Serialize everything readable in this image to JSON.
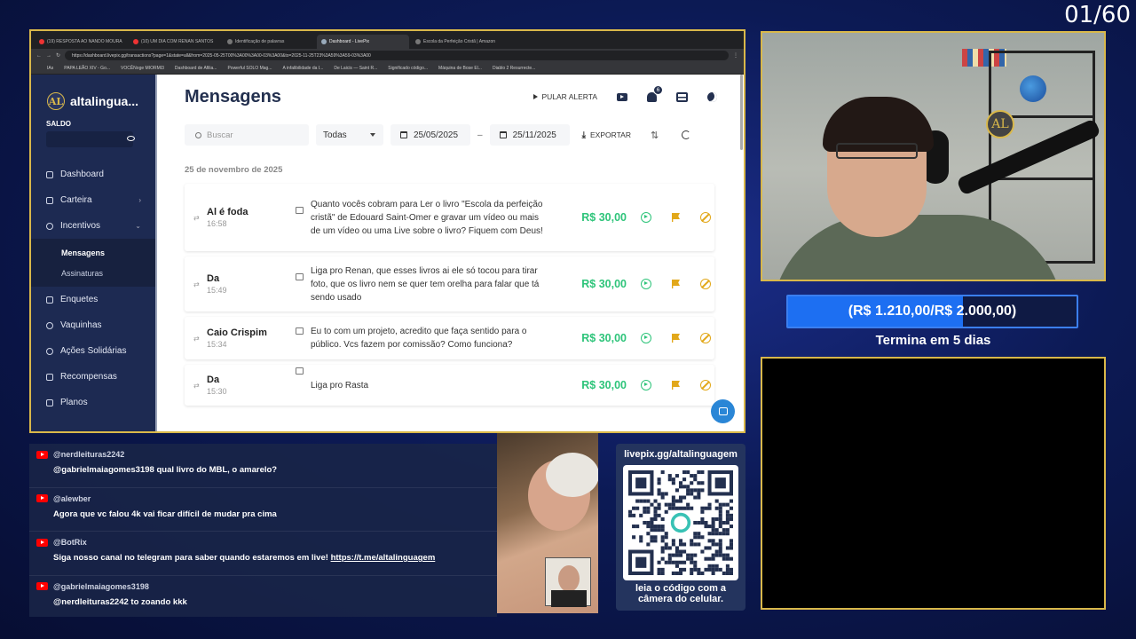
{
  "overlay": {
    "counter": "01/60"
  },
  "browser": {
    "tabs": [
      {
        "label": "(19) RESPOSTA AO NANDO MOURA",
        "icon": "youtube-icon"
      },
      {
        "label": "(10) UM DIA COM RENAN SANTOS",
        "icon": "youtube-icon"
      },
      {
        "label": "Identificação de palavras",
        "icon": "page-icon"
      },
      {
        "label": "Dashboard - LivePix",
        "icon": "livepix-icon",
        "active": true
      },
      {
        "label": "Escola da Perfeição Cristã | Amazon",
        "icon": "page-icon"
      }
    ],
    "url": "https://dashboard.livepix.gg/transactions?page=1&state=all&from=2025-05-25T00%3A00%3A00-03%3A00&to=2025-11-25T23%3A59%3A59-03%3A00",
    "bookmarks": [
      "IAs",
      "PAPA LEÃO XIV - Go...",
      "VOCÊNoge MIORMI3",
      "Dashboard de Afilia...",
      "Powerful SOLO Mag...",
      "A infalibilidade da I...",
      "De Laicis — Saint R...",
      "Significado código...",
      "Máquina de Bose El...",
      "Diablo 2 Resurrecte..."
    ]
  },
  "sidebar": {
    "brand": "altalingua...",
    "brand_mark": "AL",
    "saldo_label": "SALDO",
    "items": [
      {
        "label": "Dashboard",
        "icon": "dashboard-icon"
      },
      {
        "label": "Carteira",
        "icon": "wallet-icon",
        "chevron": "›"
      },
      {
        "label": "Incentivos",
        "icon": "incentives-icon",
        "chevron": "⌄"
      }
    ],
    "sub_items": [
      {
        "label": "Mensagens",
        "active": true
      },
      {
        "label": "Assinaturas"
      }
    ],
    "items2": [
      {
        "label": "Enquetes",
        "icon": "poll-icon"
      },
      {
        "label": "Vaquinhas",
        "icon": "crowdfund-icon"
      },
      {
        "label": "Ações Solidárias",
        "icon": "charity-icon"
      },
      {
        "label": "Recompensas",
        "icon": "reward-icon"
      },
      {
        "label": "Planos",
        "icon": "plans-icon"
      }
    ]
  },
  "main": {
    "title": "Mensagens",
    "pular_alerta": "PULAR ALERTA",
    "notif_count": "6",
    "search_placeholder": "Buscar",
    "filter_value": "Todas",
    "date_from": "25/05/2025",
    "date_sep": "–",
    "date_to": "25/11/2025",
    "export_label": "EXPORTAR",
    "date_header": "25 de novembro de 2025",
    "messages": [
      {
        "name": "Al é foda",
        "time": "16:58",
        "text": "Quanto vocês cobram para Ler o livro \"Escola da perfeição cristã\" de Edouard Saint-Omer e gravar um vídeo ou mais de um vídeo ou uma Live sobre o livro? Fiquem com Deus!",
        "amount": "R$ 30,00"
      },
      {
        "name": "Da",
        "time": "15:49",
        "text": "Liga pro Renan, que esses livros ai ele só tocou para tirar foto, que os livro nem se quer tem orelha para falar que tá sendo usado",
        "amount": "R$ 30,00"
      },
      {
        "name": "Caio Crispim",
        "time": "15:34",
        "text": "Eu to com um projeto, acredito que faça sentido para o público. Vcs fazem por comissão? Como funciona?",
        "amount": "R$ 30,00"
      },
      {
        "name": "Da",
        "time": "15:30",
        "text": "Liga pro Rasta",
        "amount": "R$ 30,00"
      }
    ]
  },
  "goal": {
    "label": "(R$ 1.210,00/R$ 2.000,00)",
    "progress": 0.605,
    "ends": "Termina em 5 dias"
  },
  "chat": [
    {
      "user": "@nerdleituras2242",
      "text": "@gabrielmaiagomes3198 qual livro do MBL, o amarelo?"
    },
    {
      "user": "@alewber",
      "text": "Agora que vc falou 4k vai ficar difícil de mudar pra cima"
    },
    {
      "user": "@BotRix",
      "text": "Siga nosso canal no telegram para saber quando estaremos em live! ",
      "link": "https://t.me/altalinguagem"
    },
    {
      "user": "@gabrielmaiagomes3198",
      "text": "@nerdleituras2242 to zoando kkk"
    }
  ],
  "qr": {
    "url": "livepix.gg/altalinguagem",
    "caption_1": "leia o código com a",
    "caption_2": "câmera do celular."
  },
  "colors": {
    "accent_gold": "#d9b84a",
    "sidebar": "#1d2a52",
    "amount_green": "#2ec47a",
    "flag_amber": "#e2a81a",
    "goal_blue": "#1d6ff2"
  }
}
